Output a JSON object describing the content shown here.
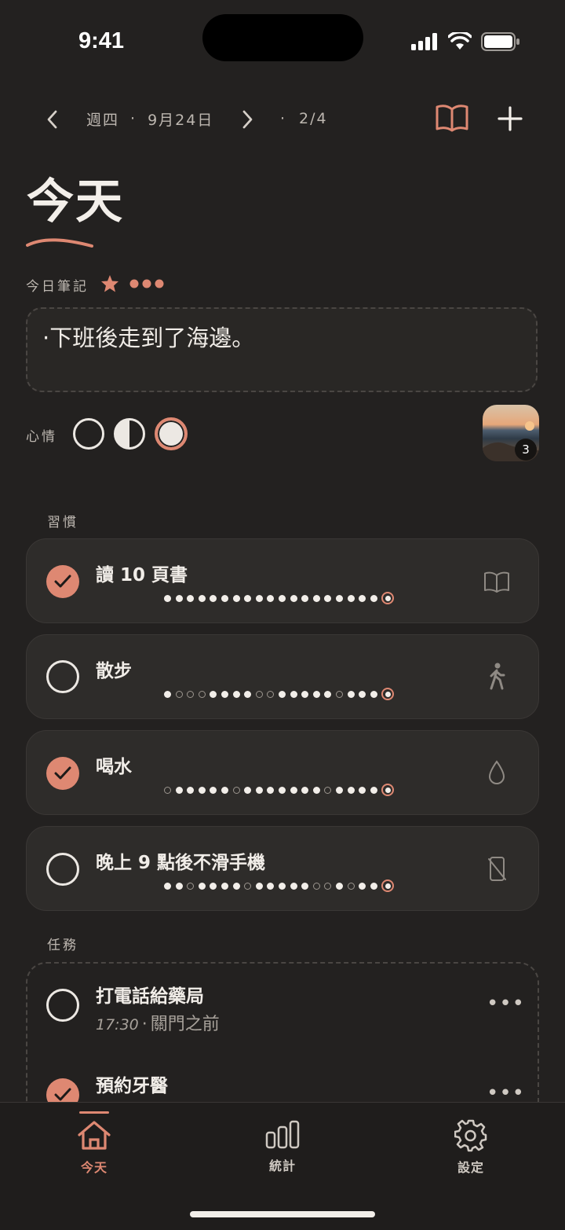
{
  "status": {
    "time": "9:41"
  },
  "header": {
    "weekday": "週四",
    "date": "9月24日",
    "page": "2/4"
  },
  "title": "今天",
  "note": {
    "label": "今日筆記",
    "text": "·下班後走到了海邊。"
  },
  "mood": {
    "label": "心情",
    "selected": 2
  },
  "photos": {
    "count": "3"
  },
  "habits": {
    "label": "習慣",
    "items": [
      {
        "name": "讀 10 頁書",
        "done": true,
        "icon": "book-icon",
        "history": "11111111111111111111"
      },
      {
        "name": "散步",
        "done": false,
        "icon": "walking-icon",
        "history": "10001111001111101111"
      },
      {
        "name": "喝水",
        "done": true,
        "icon": "water-drop-icon",
        "history": "01111101111111011111"
      },
      {
        "name": "晚上 9 點後不滑手機",
        "done": false,
        "icon": "phone-off-icon",
        "history": "11011110111110010111"
      }
    ]
  },
  "tasks": {
    "label": "任務",
    "items": [
      {
        "name": "打電話給藥局",
        "time": "17:30",
        "note": "關門之前",
        "done": false
      },
      {
        "name": "預約牙醫",
        "done": true
      }
    ]
  },
  "tabs": [
    {
      "label": "今天",
      "icon": "home-icon",
      "active": true
    },
    {
      "label": "統計",
      "icon": "stats-icon",
      "active": false
    },
    {
      "label": "設定",
      "icon": "gear-icon",
      "active": false
    }
  ],
  "colors": {
    "accent": "#de8872",
    "background": "#232120",
    "card": "#2e2c2a"
  }
}
